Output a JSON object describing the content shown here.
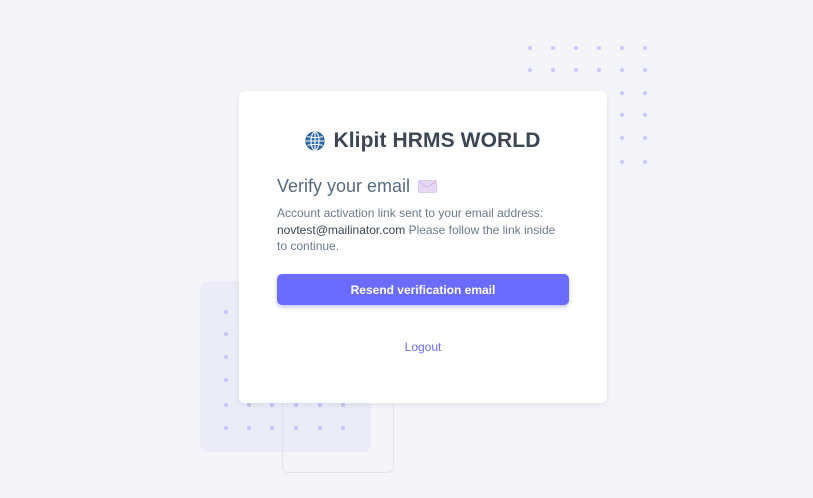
{
  "brand": {
    "name": "Klipit HRMS WORLD",
    "icon": "globe-icon"
  },
  "verify": {
    "title": "Verify your email",
    "title_icon": "envelope-icon",
    "message_prefix": "Account activation link sent to your email address:",
    "email": "novtest@mailinator.com",
    "message_suffix": "Please follow the link inside to continue."
  },
  "actions": {
    "resend_label": "Resend verification email",
    "logout_label": "Logout"
  },
  "colors": {
    "primary": "#696cff",
    "background": "#f5f5f9",
    "heading": "#566a7f",
    "body_text": "#697a8d",
    "dot": "#c8c9ff"
  }
}
